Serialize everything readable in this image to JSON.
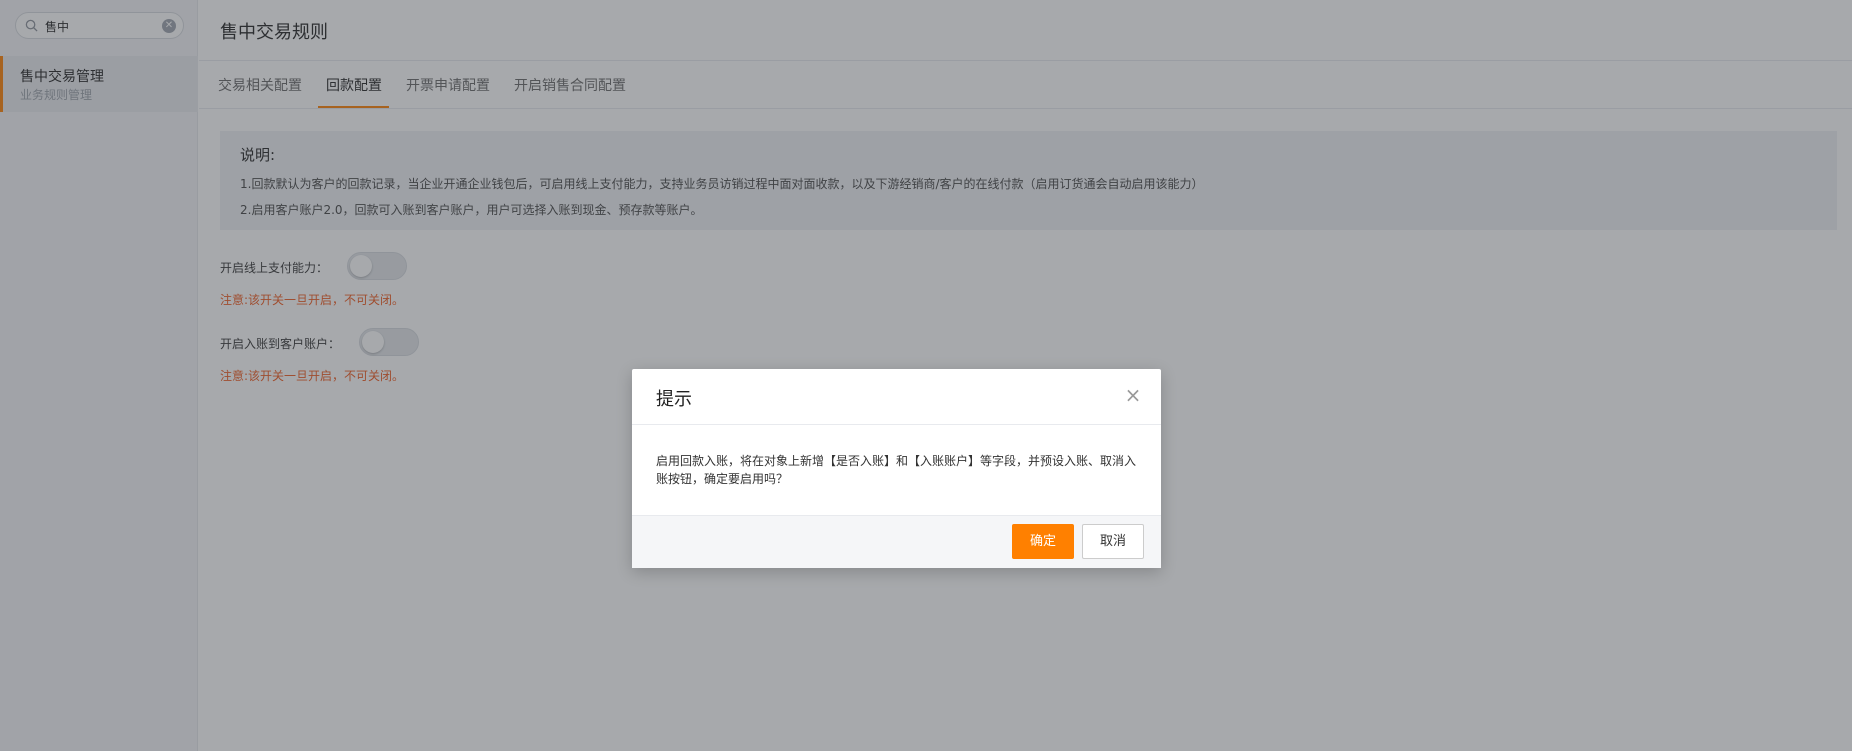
{
  "sidebar": {
    "search": {
      "value": "售中",
      "clear_icon": "close-circle-icon"
    },
    "items": [
      {
        "title": "售中交易管理",
        "subtitle": "业务规则管理",
        "active": true
      }
    ]
  },
  "main": {
    "title": "售中交易规则",
    "tabs": [
      {
        "label": "交易相关配置",
        "active": false
      },
      {
        "label": "回款配置",
        "active": true
      },
      {
        "label": "开票申请配置",
        "active": false
      },
      {
        "label": "开启销售合同配置",
        "active": false
      }
    ],
    "note": {
      "title": "说明:",
      "lines": [
        "1.回款默认为客户的回款记录，当企业开通企业钱包后，可启用线上支付能力，支持业务员访销过程中面对面收款，以及下游经销商/客户的在线付款（启用订货通会自动启用该能力）",
        "2.启用客户账户2.0，回款可入账到客户账户，用户可选择入账到现金、预存款等账户。"
      ]
    },
    "settings": [
      {
        "label": "开启线上支付能力：",
        "enabled": false,
        "warning": "注意:该开关一旦开启，不可关闭。"
      },
      {
        "label": "开启入账到客户账户：",
        "enabled": false,
        "warning": "注意:该开关一旦开启，不可关闭。"
      }
    ]
  },
  "dialog": {
    "title": "提示",
    "message": "启用回款入账，将在对象上新增【是否入账】和【入账账户】等字段，并预设入账、取消入账按钮，确定要启用吗？",
    "confirm_label": "确定",
    "cancel_label": "取消",
    "close_symbol": "×"
  },
  "colors": {
    "accent": "#ff8000",
    "warning_text": "#f0591e",
    "overlay": "rgba(60,64,72,0.45)"
  }
}
